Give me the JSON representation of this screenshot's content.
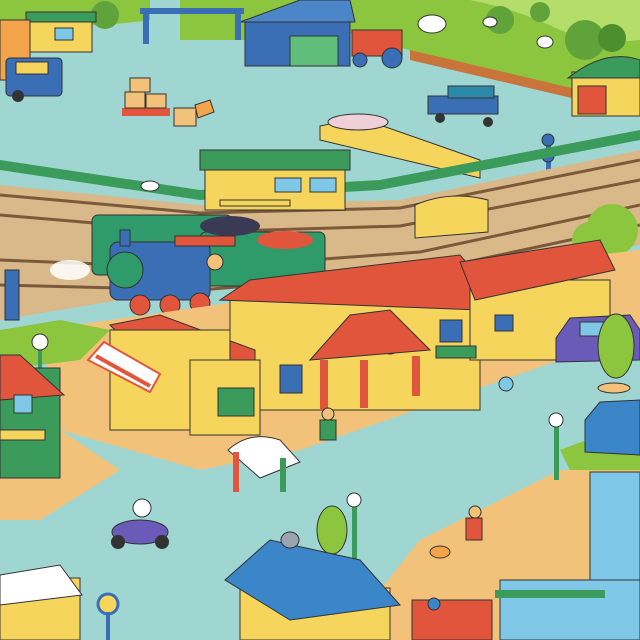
{
  "scene": {
    "description_tags": [
      "train-station",
      "town",
      "farm",
      "illustration"
    ],
    "colors": {
      "grass": "#8cc63f",
      "grass_dark": "#5fa33a",
      "pavement": "#9fd6d2",
      "sidewalk": "#f3c27a",
      "roof_red": "#e2553d",
      "wall_yellow": "#f6d55c",
      "train_green": "#2f9a6a",
      "train_blue": "#3a6fb5",
      "rail_brown": "#a0784c",
      "fence_green": "#3b9b5a",
      "sky_cream": "#f4e9c4"
    }
  }
}
